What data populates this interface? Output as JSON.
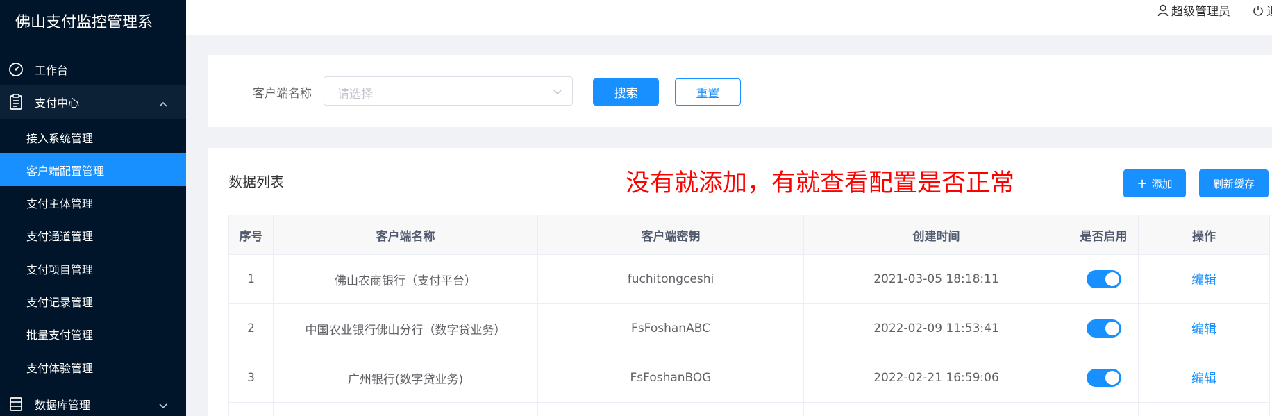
{
  "app": {
    "title": "佛山支付监控管理系"
  },
  "header": {
    "user_label": "超级管理员",
    "logout_label": "退"
  },
  "sidebar": {
    "dashboard_label": "工作台",
    "payment_center_label": "支付中心",
    "sub_items": [
      "接入系统管理",
      "客户端配置管理",
      "支付主体管理",
      "支付通道管理",
      "支付项目管理",
      "支付记录管理",
      "批量支付管理",
      "支付体验管理"
    ],
    "active_index": 1,
    "database_label": "数据库管理"
  },
  "search": {
    "label": "客户端名称",
    "placeholder": "请选择",
    "search_button": "搜索",
    "reset_button": "重置"
  },
  "list": {
    "title": "数据列表",
    "annotation": "没有就添加，有就查看配置是否正常",
    "add_button": "添加",
    "add_icon": "+",
    "refresh_button": "刷新缓存",
    "columns": [
      "序号",
      "客户端名称",
      "客户端密钥",
      "创建时间",
      "是否启用",
      "操作"
    ],
    "rows": [
      {
        "index": "1",
        "name": "佛山农商银行（支付平台）",
        "secret": "fuchitongceshi",
        "created": "2021-03-05 18:18:11",
        "enabled": true,
        "action": "编辑"
      },
      {
        "index": "2",
        "name": "中国农业银行佛山分行（数字贷业务）",
        "secret": "FsFoshanABC",
        "created": "2022-02-09 11:53:41",
        "enabled": true,
        "action": "编辑"
      },
      {
        "index": "3",
        "name": "广州银行(数字贷业务)",
        "secret": "FsFoshanBOG",
        "created": "2022-02-21 16:59:06",
        "enabled": true,
        "action": "编辑"
      }
    ]
  },
  "colors": {
    "sidebar_bg": "#001529",
    "primary": "#1890ff",
    "annotation": "#ff0000"
  },
  "icons": {
    "dashboard": "speedometer-icon",
    "payment": "clipboard-icon",
    "database": "database-icon",
    "user": "user-icon",
    "logout": "power-icon"
  }
}
